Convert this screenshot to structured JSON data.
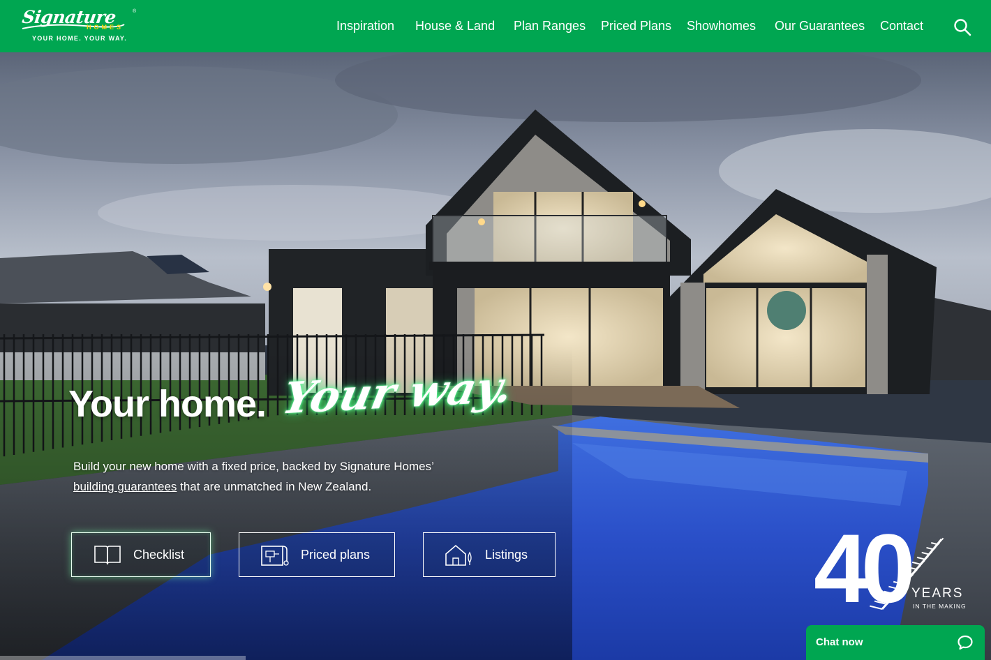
{
  "brand": {
    "logo_script": "Signature",
    "logo_homes": "HOMES",
    "logo_est": "EST 1983",
    "tagline": "YOUR HOME. YOUR WAY.",
    "primary_color": "#00a651",
    "accent_color": "#f5d40f"
  },
  "nav": {
    "items": [
      {
        "label": "Inspiration"
      },
      {
        "label": "House & Land"
      },
      {
        "label": "Plan Ranges"
      },
      {
        "label": "Priced Plans"
      },
      {
        "label": "Showhomes"
      },
      {
        "label": "Our Guarantees"
      },
      {
        "label": "Contact"
      }
    ],
    "search_icon": "search-icon"
  },
  "hero": {
    "headline": "Your home.",
    "headline_script": "Your way.",
    "intro_before": "Build your new home with a fixed price, backed by Signature Homes’ ",
    "intro_link": "building guarantees",
    "intro_after": " that are unmatched in New Zealand.",
    "buttons": [
      {
        "label": "Checklist",
        "icon": "book-icon"
      },
      {
        "label": "Priced plans",
        "icon": "floor-plan-icon"
      },
      {
        "label": "Listings",
        "icon": "house-icon"
      }
    ]
  },
  "badge": {
    "number": "40",
    "years": "YEARS",
    "subtitle": "IN THE MAKING",
    "icon": "silver-fern-icon"
  },
  "chat": {
    "label": "Chat now",
    "icon": "chat-bubble-icon"
  }
}
